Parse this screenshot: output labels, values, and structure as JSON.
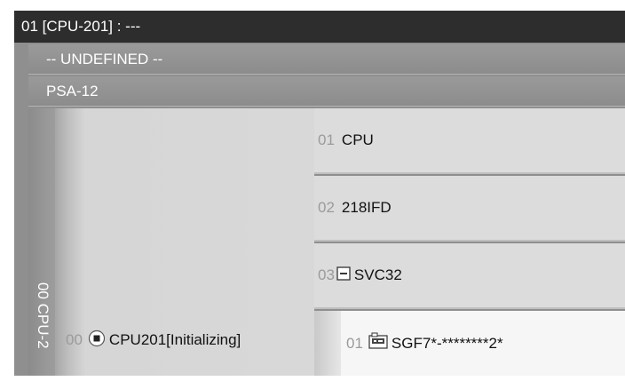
{
  "window": {
    "title": "01 [CPU-201] : ---"
  },
  "modules": {
    "undefined_label": "-- UNDEFINED --",
    "psa_label": "PSA-12"
  },
  "rack": {
    "label": "00 CPU-2"
  },
  "cpu": {
    "slot": "00",
    "name": "CPU201[Initializing]",
    "icon": "stop-radio-icon"
  },
  "slots": [
    {
      "num": "01",
      "name": "CPU"
    },
    {
      "num": "02",
      "name": "218IFD"
    },
    {
      "num": "03",
      "name": "SVC32",
      "icon": "collapse-box-icon"
    }
  ],
  "subslot": {
    "num": "01",
    "name": "SGF7*-********2*",
    "icon": "servo-device-icon"
  },
  "colors": {
    "titlebar": "#2d2d2d",
    "module_row": "#8f8f8f",
    "panel": "#d8d8d8",
    "selected": "#f6f6f6"
  }
}
